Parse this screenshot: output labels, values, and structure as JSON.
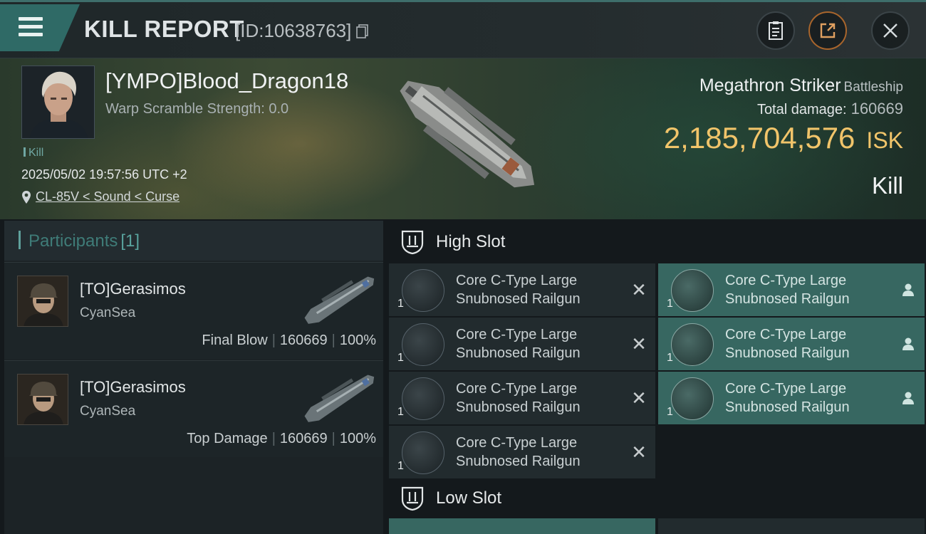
{
  "header": {
    "title": "KILL REPORT",
    "report_id": "[ID:10638763]"
  },
  "victim": {
    "name": "[YMPO]Blood_Dragon18",
    "warp_scramble": "Warp Scramble Strength: 0.0",
    "tag": "Kill",
    "datetime": "2025/05/02 19:57:56 UTC +2",
    "location": "CL-85V < Sound < Curse",
    "ship_name": "Megathron Striker",
    "ship_class": "Battleship",
    "total_damage_label": "Total damage:",
    "total_damage": "160669",
    "isk_value": "2,185,704,576",
    "isk_unit": "ISK",
    "result": "Kill"
  },
  "participants": {
    "label": "Participants",
    "count": "[1]",
    "rows": [
      {
        "name": "[TO]Gerasimos",
        "corp": "CyanSea",
        "role": "Final Blow",
        "damage": "160669",
        "percent": "100%"
      },
      {
        "name": "[TO]Gerasimos",
        "corp": "CyanSea",
        "role": "Top Damage",
        "damage": "160669",
        "percent": "100%"
      }
    ]
  },
  "slots": {
    "high_label": "High Slot",
    "low_label": "Low Slot",
    "high": [
      {
        "name": "Core C-Type Large Snubnosed Railgun",
        "qty": "1",
        "state": "destroyed"
      },
      {
        "name": "Core C-Type Large Snubnosed Railgun",
        "qty": "1",
        "state": "dropped"
      },
      {
        "name": "Core C-Type Large Snubnosed Railgun",
        "qty": "1",
        "state": "destroyed"
      },
      {
        "name": "Core C-Type Large Snubnosed Railgun",
        "qty": "1",
        "state": "dropped"
      },
      {
        "name": "Core C-Type Large Snubnosed Railgun",
        "qty": "1",
        "state": "destroyed"
      },
      {
        "name": "Core C-Type Large Snubnosed Railgun",
        "qty": "1",
        "state": "dropped"
      },
      {
        "name": "Core C-Type Large Snubnosed Railgun",
        "qty": "1",
        "state": "destroyed"
      }
    ]
  },
  "icons": {
    "menu": "menu-icon",
    "copy": "copy-icon",
    "clipboard": "clipboard-icon",
    "share": "share-icon",
    "close": "close-icon",
    "location": "location-pin-icon",
    "slot": "shield-slot-icon",
    "destroyed": "x-icon",
    "dropped": "person-icon"
  },
  "colors": {
    "accent_teal": "#376761",
    "isk_gold": "#f1c46a",
    "share_orange": "#a8652c"
  }
}
